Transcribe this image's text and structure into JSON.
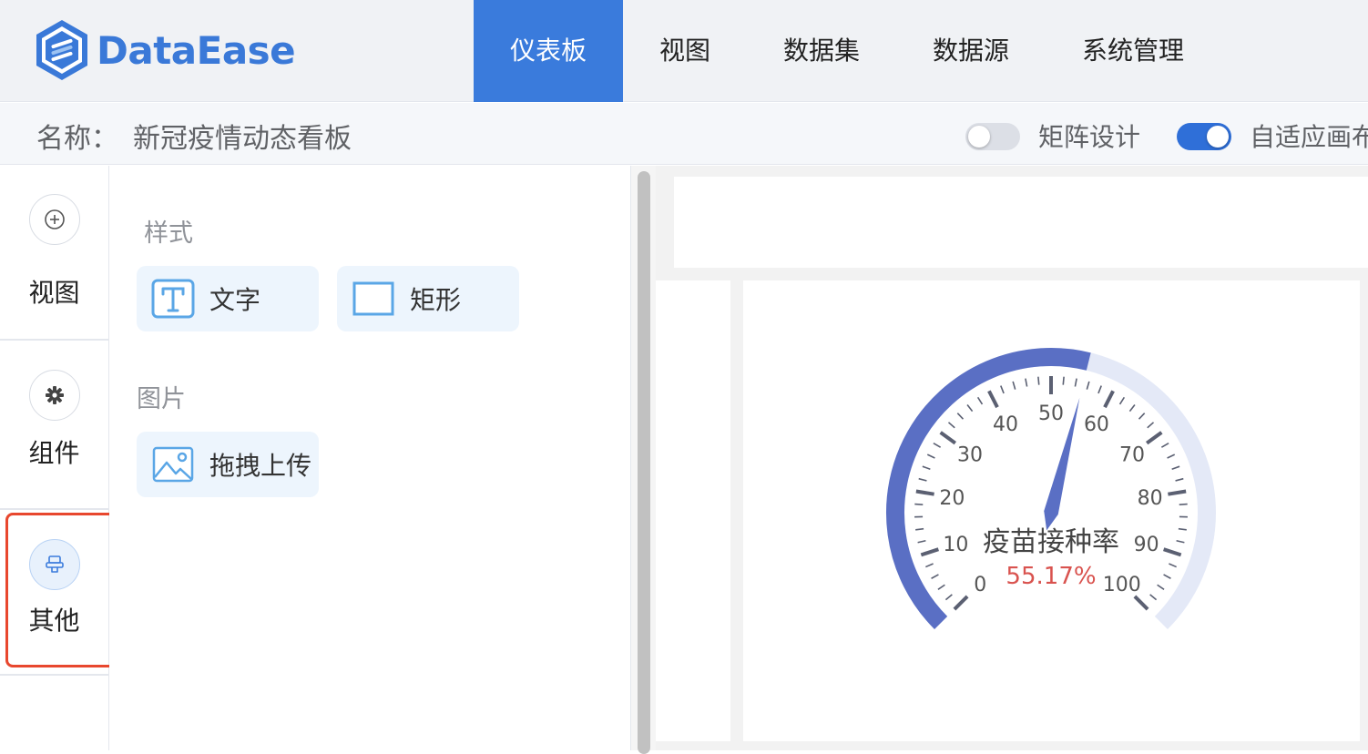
{
  "app": {
    "logo_text": "DataEase",
    "nav": [
      "仪表板",
      "视图",
      "数据集",
      "数据源",
      "系统管理"
    ],
    "active_nav": 0,
    "brand_color": "#3a7bdc"
  },
  "toolbar": {
    "name_label": "名称：",
    "name_value": "新冠疫情动态看板",
    "matrix_design_label": "矩阵设计",
    "matrix_design_on": false,
    "auto_fit_label": "自适应画布",
    "auto_fit_on": true
  },
  "rail": {
    "items": [
      {
        "label": "视图",
        "icon": "plus-circle-icon"
      },
      {
        "label": "组件",
        "icon": "gear-icon"
      },
      {
        "label": "其他",
        "icon": "stamp-icon",
        "selected": true
      }
    ]
  },
  "panel": {
    "style_title": "样式",
    "style_items": [
      {
        "label": "文字",
        "icon": "text-icon"
      },
      {
        "label": "矩形",
        "icon": "rectangle-icon"
      }
    ],
    "image_title": "图片",
    "image_items": [
      {
        "label": "拖拽上传",
        "icon": "image-icon"
      }
    ]
  },
  "chart_data": {
    "type": "gauge",
    "title": "疫苗接种率",
    "value": 55.17,
    "value_label": "55.17%",
    "min": 0,
    "max": 100,
    "tick_labels": [
      "0",
      "10",
      "20",
      "30",
      "40",
      "50",
      "60",
      "70",
      "80",
      "90",
      "100"
    ],
    "progress_color": "#5a6fc4",
    "track_color": "#e4e9f7",
    "value_color": "#d9534f"
  }
}
